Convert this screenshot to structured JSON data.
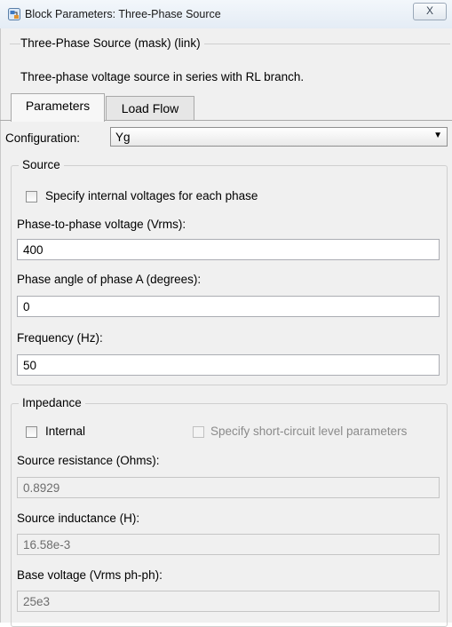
{
  "window": {
    "title": "Block Parameters: Three-Phase Source",
    "close_glyph": "X",
    "app_icon": "simulink-block-icon"
  },
  "mask": {
    "title": "Three-Phase Source (mask) (link)",
    "description": "Three-phase voltage source in series with RL branch."
  },
  "tabs": [
    {
      "label": "Parameters",
      "active": true
    },
    {
      "label": "Load Flow",
      "active": false
    }
  ],
  "configuration": {
    "label": "Configuration:",
    "value": "Yg"
  },
  "source": {
    "legend": "Source",
    "specify_internal": {
      "label": "Specify internal voltages for each phase",
      "checked": false
    },
    "fields": [
      {
        "label": "Phase-to-phase voltage (Vrms):",
        "value": "400"
      },
      {
        "label": "Phase angle of phase A (degrees):",
        "value": "0"
      },
      {
        "label": "Frequency (Hz):",
        "value": "50"
      }
    ]
  },
  "impedance": {
    "legend": "Impedance",
    "internal": {
      "label": "Internal",
      "checked": false
    },
    "short_circuit": {
      "label": "Specify short-circuit level parameters",
      "checked": false,
      "enabled": false
    },
    "fields": [
      {
        "label": "Source resistance (Ohms):",
        "value": "0.8929"
      },
      {
        "label": "Source inductance (H):",
        "value": "16.58e-3"
      },
      {
        "label": "Base voltage (Vrms ph-ph):",
        "value": "25e3"
      }
    ]
  }
}
